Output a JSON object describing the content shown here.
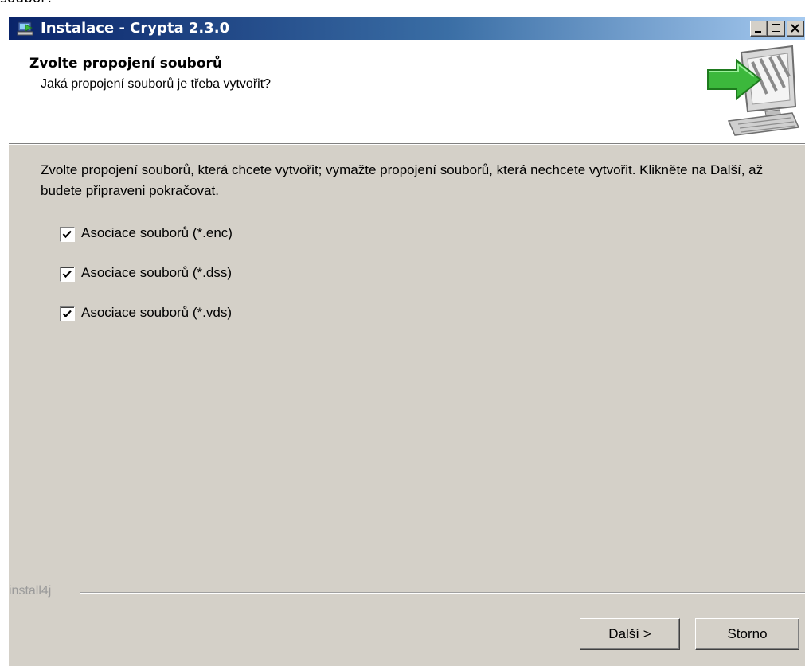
{
  "top_fragment": "soubor?",
  "window": {
    "title": "Instalace - Crypta 2.3.0",
    "app_icon": "installer-icon",
    "controls": [
      "minimize-icon",
      "maximize-icon",
      "close-icon"
    ]
  },
  "header": {
    "title": "Zvolte propojení souborů",
    "subtitle": "Jaká propojení souborů je třeba vytvořit?",
    "graphic": "computer-arrow-icon"
  },
  "body": {
    "description": "Zvolte propojení souborů, která chcete vytvořit; vymažte propojení souborů, která nechcete vytvořit. Klikněte na Další, až budete připraveni pokračovat.",
    "options": [
      {
        "label": "Asociace souborů (*.enc)",
        "checked": true
      },
      {
        "label": "Asociace souborů (*.dss)",
        "checked": true
      },
      {
        "label": "Asociace souborů (*.vds)",
        "checked": true
      }
    ]
  },
  "footer": {
    "branding": "install4j",
    "next_label": "Další >",
    "cancel_label": "Storno"
  },
  "colors": {
    "dialog_bg": "#d4d0c8",
    "title_gradient_start": "#0a246a",
    "title_gradient_end": "#a6caf0",
    "arrow_green": "#3cb83c"
  }
}
